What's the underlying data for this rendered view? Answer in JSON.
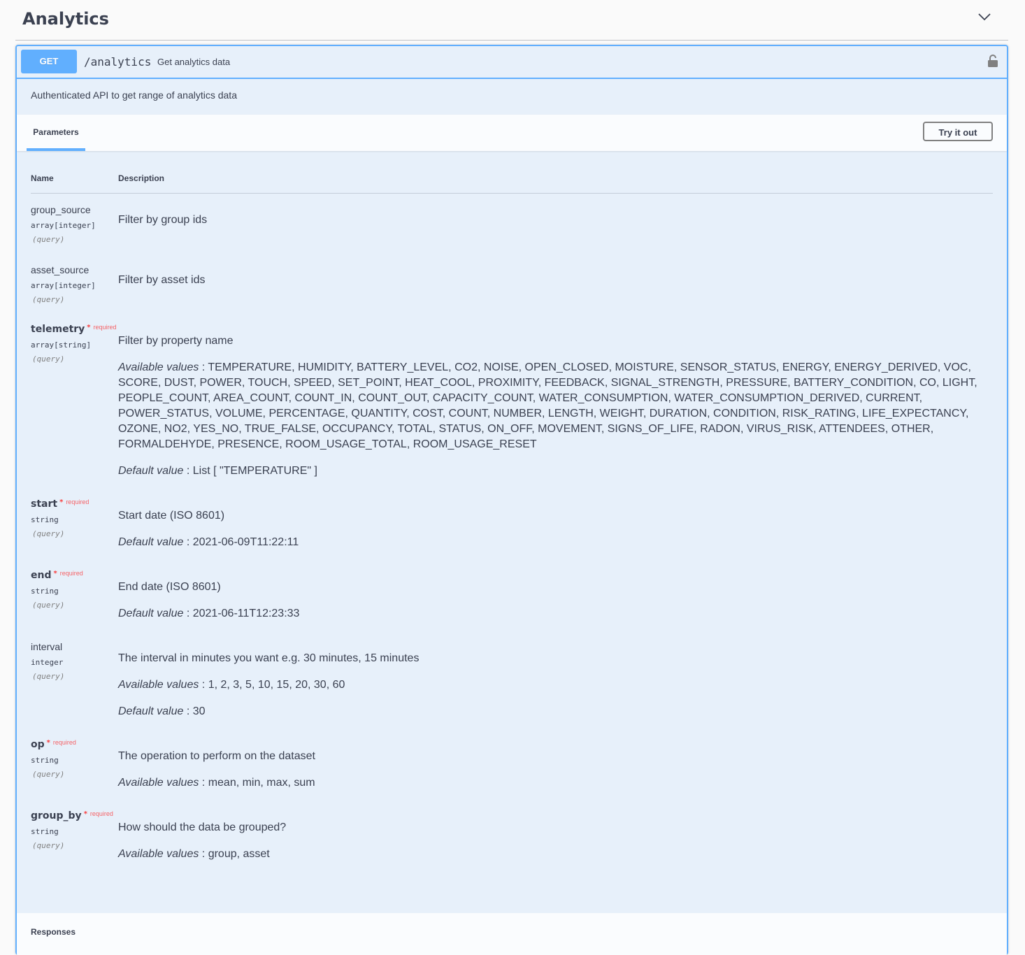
{
  "section": {
    "title": "Analytics",
    "chevron_icon": "chevron-down-icon"
  },
  "operation": {
    "method": "GET",
    "path": "/analytics",
    "summary": "Get analytics data",
    "description": "Authenticated API to get range of analytics data",
    "lock_icon": "lock-icon",
    "accent_color": "#61affe"
  },
  "parameters_panel": {
    "tab_label": "Parameters",
    "try_button": "Try it out",
    "col_name": "Name",
    "col_description": "Description",
    "required_label": "required",
    "required_star": "*"
  },
  "params": [
    {
      "name": "group_source",
      "type": "array[integer]",
      "in": "(query)",
      "required": false,
      "description": "Filter by group ids"
    },
    {
      "name": "asset_source",
      "type": "array[integer]",
      "in": "(query)",
      "required": false,
      "description": "Filter by asset ids"
    },
    {
      "name": "telemetry",
      "type": "array[string]",
      "in": "(query)",
      "required": true,
      "description": "Filter by property name",
      "available_label": "Available values",
      "available": "TEMPERATURE, HUMIDITY, BATTERY_LEVEL, CO2, NOISE, OPEN_CLOSED, MOISTURE, SENSOR_STATUS, ENERGY, ENERGY_DERIVED, VOC, SCORE, DUST, POWER, TOUCH, SPEED, SET_POINT, HEAT_COOL, PROXIMITY, FEEDBACK, SIGNAL_STRENGTH, PRESSURE, BATTERY_CONDITION, CO, LIGHT, PEOPLE_COUNT, AREA_COUNT, COUNT_IN, COUNT_OUT, CAPACITY_COUNT, WATER_CONSUMPTION, WATER_CONSUMPTION_DERIVED, CURRENT, POWER_STATUS, VOLUME, PERCENTAGE, QUANTITY, COST, COUNT, NUMBER, LENGTH, WEIGHT, DURATION, CONDITION, RISK_RATING, LIFE_EXPECTANCY, OZONE, NO2, YES_NO, TRUE_FALSE, OCCUPANCY, TOTAL, STATUS, ON_OFF, MOVEMENT, SIGNS_OF_LIFE, RADON, VIRUS_RISK, ATTENDEES, OTHER, FORMALDEHYDE, PRESENCE, ROOM_USAGE_TOTAL, ROOM_USAGE_RESET",
      "default_label": "Default value",
      "default": "List [ \"TEMPERATURE\" ]"
    },
    {
      "name": "start",
      "type": "string",
      "in": "(query)",
      "required": true,
      "description": "Start date (ISO 8601)",
      "default_label": "Default value",
      "default": "2021-06-09T11:22:11"
    },
    {
      "name": "end",
      "type": "string",
      "in": "(query)",
      "required": true,
      "description": "End date (ISO 8601)",
      "default_label": "Default value",
      "default": "2021-06-11T12:23:33"
    },
    {
      "name": "interval",
      "type": "integer",
      "in": "(query)",
      "required": false,
      "description": "The interval in minutes you want e.g. 30 minutes, 15 minutes",
      "available_label": "Available values",
      "available": "1, 2, 3, 5, 10, 15, 20, 30, 60",
      "default_label": "Default value",
      "default": "30"
    },
    {
      "name": "op",
      "type": "string",
      "in": "(query)",
      "required": true,
      "description": "The operation to perform on the dataset",
      "available_label": "Available values",
      "available": "mean, min, max, sum"
    },
    {
      "name": "group_by",
      "type": "string",
      "in": "(query)",
      "required": true,
      "description": "How should the data be grouped?",
      "available_label": "Available values",
      "available": "group, asset"
    }
  ],
  "responses": {
    "title": "Responses"
  }
}
